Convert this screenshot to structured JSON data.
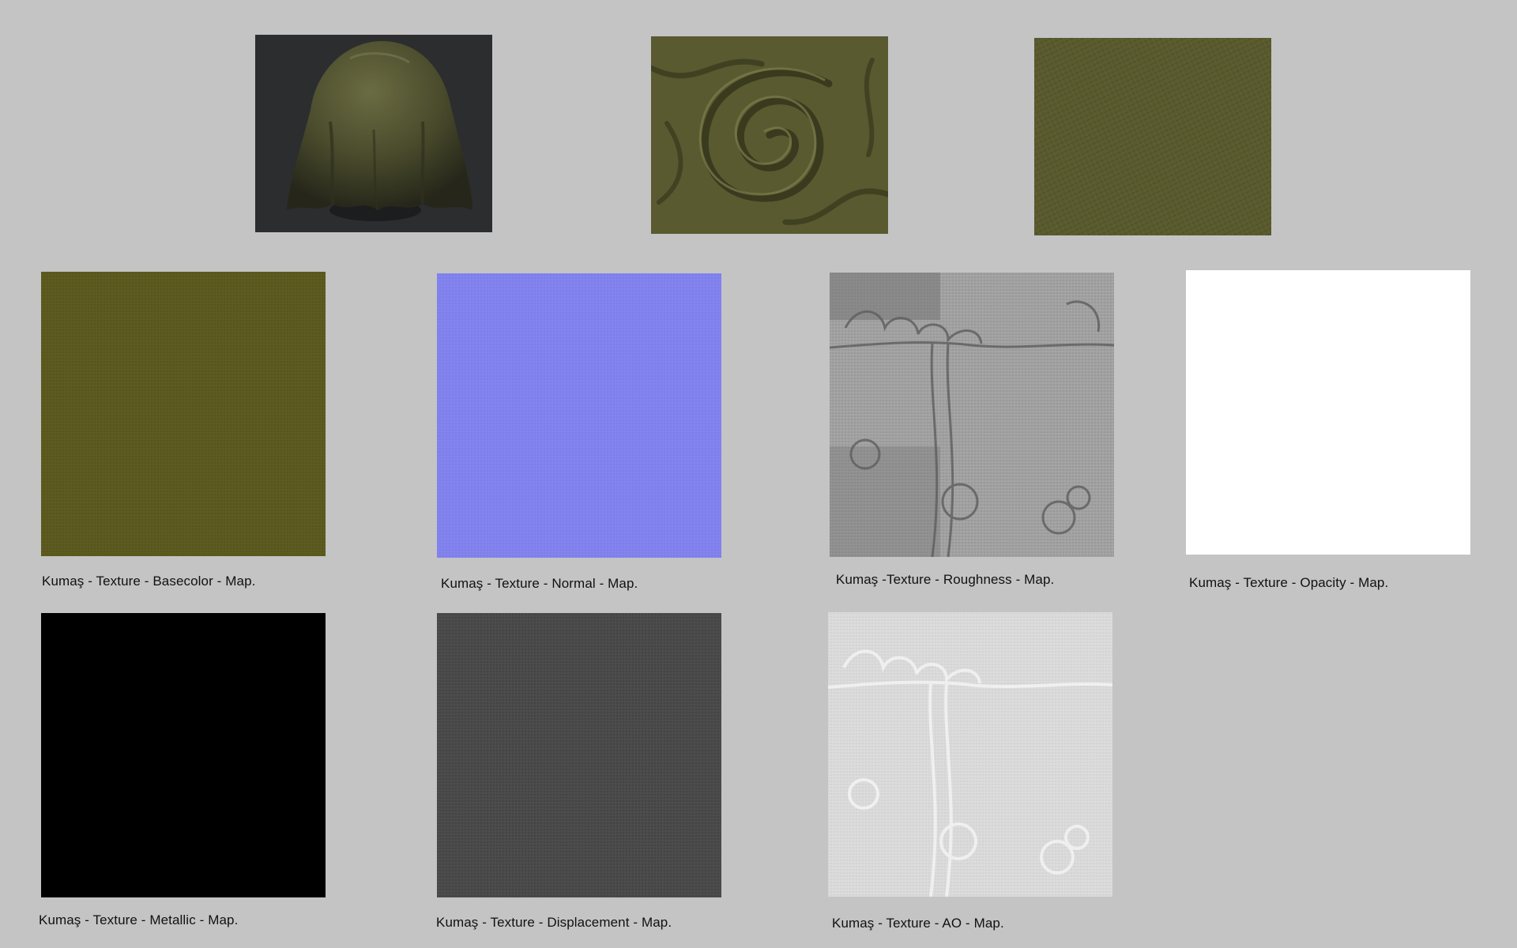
{
  "maps": {
    "basecolor": {
      "caption": "Kumaş - Texture - Basecolor - Map."
    },
    "normal": {
      "caption": "Kumaş - Texture - Normal - Map."
    },
    "roughness": {
      "caption": "Kumaş -Texture - Roughness - Map."
    },
    "opacity": {
      "caption": "Kumaş - Texture - Opacity - Map."
    },
    "metallic": {
      "caption": "Kumaş - Texture - Metallic - Map."
    },
    "displacement": {
      "caption": "Kumaş - Texture - Displacement - Map."
    },
    "ao": {
      "caption": "Kumaş - Texture - AO - Map."
    }
  },
  "colors": {
    "page_background": "#c4c4c4",
    "fabric_olive": "#5a5a26",
    "normal_map_blue": "#8080f0",
    "opacity_white": "#ffffff",
    "metallic_black": "#000000",
    "displacement_gray": "#4a4a4a",
    "ao_light_gray": "#dcdcdc",
    "roughness_gray": "#9a9a9a",
    "preview_backdrop": "#2a2b2d"
  }
}
